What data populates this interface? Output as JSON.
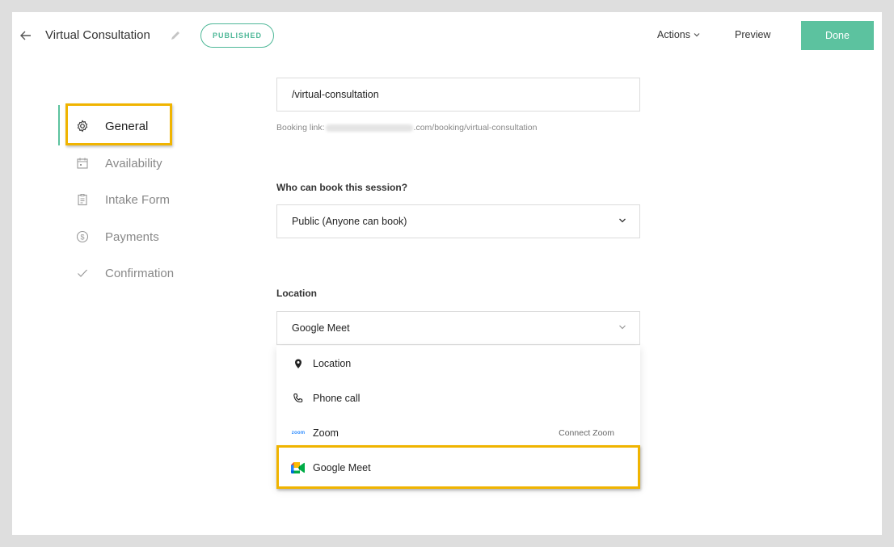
{
  "header": {
    "title": "Virtual Consultation",
    "status_badge": "PUBLISHED",
    "actions_label": "Actions",
    "preview_label": "Preview",
    "done_label": "Done"
  },
  "sidebar": {
    "items": [
      {
        "label": "General",
        "icon": "gear-icon",
        "active": true
      },
      {
        "label": "Availability",
        "icon": "calendar-icon",
        "active": false
      },
      {
        "label": "Intake Form",
        "icon": "clipboard-icon",
        "active": false
      },
      {
        "label": "Payments",
        "icon": "dollar-circle-icon",
        "active": false
      },
      {
        "label": "Confirmation",
        "icon": "check-icon",
        "active": false
      }
    ]
  },
  "form": {
    "slug_value": "/virtual-consultation",
    "booking_link_prefix": "Booking link:",
    "booking_link_suffix": ".com/booking/virtual-consultation",
    "who_can_book_label": "Who can book this session?",
    "who_can_book_value": "Public (Anyone can book)",
    "location_label": "Location",
    "location_value": "Google Meet"
  },
  "location_options": [
    {
      "label": "Location",
      "icon": "map-pin-icon"
    },
    {
      "label": "Phone call",
      "icon": "phone-icon"
    },
    {
      "label": "Zoom",
      "icon": "zoom-logo-icon",
      "logo_text": "zoom",
      "action": "Connect Zoom"
    },
    {
      "label": "Google Meet",
      "icon": "google-meet-icon"
    }
  ],
  "colors": {
    "accent": "#5cc29f",
    "highlight": "#f0b400",
    "background": "#dedede"
  }
}
